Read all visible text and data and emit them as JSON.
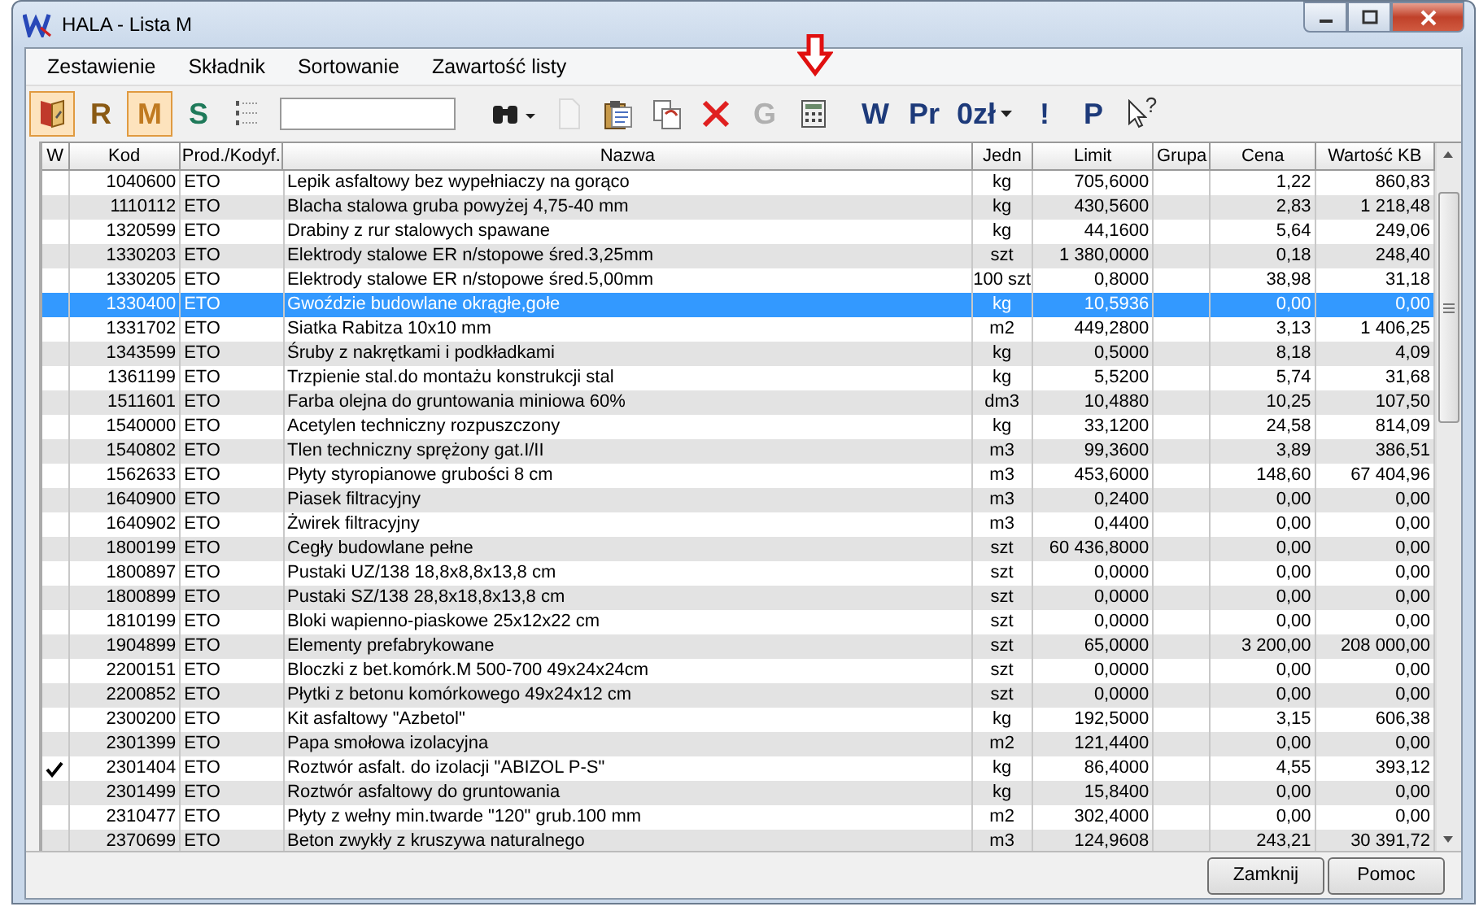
{
  "window": {
    "title": "HALA - Lista M"
  },
  "menu": [
    {
      "label": "Zestawienie"
    },
    {
      "label": "Składnik"
    },
    {
      "label": "Sortowanie"
    },
    {
      "label": "Zawartość listy"
    }
  ],
  "toolbar": [
    {
      "kind": "book",
      "selected": true
    },
    {
      "kind": "letter",
      "label": "R",
      "color": "#8a5a14",
      "selected": false
    },
    {
      "kind": "letter",
      "label": "M",
      "color": "#c07a20",
      "selected": true
    },
    {
      "kind": "letter",
      "label": "S",
      "color": "#1f7a5a",
      "selected": false
    },
    {
      "kind": "numbered-list"
    },
    {
      "kind": "search"
    },
    {
      "kind": "binoculars"
    },
    {
      "kind": "document",
      "disabled": true
    },
    {
      "kind": "clipboard"
    },
    {
      "kind": "copy"
    },
    {
      "kind": "delete"
    },
    {
      "kind": "letter",
      "label": "G",
      "color": "#b0b0b0",
      "selected": false
    },
    {
      "kind": "calculator",
      "highlighted": true
    },
    {
      "kind": "letter",
      "label": "W",
      "color": "#1d3a7a",
      "selected": false
    },
    {
      "kind": "letter",
      "label": "Pr",
      "color": "#1d3a7a",
      "selected": false
    },
    {
      "kind": "dropdown-letter",
      "label": "0zł",
      "color": "#1d3a7a",
      "selected": false
    },
    {
      "kind": "letter",
      "label": "!",
      "color": "#1d3a7a",
      "selected": false
    },
    {
      "kind": "letter",
      "label": "P",
      "color": "#1d3a7a",
      "selected": false
    },
    {
      "kind": "help-pointer",
      "label": "?"
    }
  ],
  "table": {
    "columns": [
      "W",
      "Kod",
      "Prod./Kodyf.",
      "Nazwa",
      "Jedn",
      "Limit",
      "Grupa",
      "Cena",
      "Wartość KB"
    ],
    "rows": [
      {
        "checked": false,
        "selected": false,
        "kod": "1040600",
        "prod": "ETO",
        "nazwa": "Lepik asfaltowy bez wypełniaczy na gorąco",
        "jedn": "kg",
        "limit": "705,6000",
        "cena": "1,22",
        "wartosc": "860,83"
      },
      {
        "checked": false,
        "selected": false,
        "kod": "1110112",
        "prod": "ETO",
        "nazwa": "Blacha stalowa gruba powyżej 4,75-40 mm",
        "jedn": "kg",
        "limit": "430,5600",
        "cena": "2,83",
        "wartosc": "1 218,48"
      },
      {
        "checked": false,
        "selected": false,
        "kod": "1320599",
        "prod": "ETO",
        "nazwa": "Drabiny z rur stalowych spawane",
        "jedn": "kg",
        "limit": "44,1600",
        "cena": "5,64",
        "wartosc": "249,06"
      },
      {
        "checked": false,
        "selected": false,
        "kod": "1330203",
        "prod": "ETO",
        "nazwa": "Elektrody stalowe ER n/stopowe śred.3,25mm",
        "jedn": "szt",
        "limit": "1 380,0000",
        "cena": "0,18",
        "wartosc": "248,40"
      },
      {
        "checked": false,
        "selected": false,
        "kod": "1330205",
        "prod": "ETO",
        "nazwa": "Elektrody stalowe ER n/stopowe śred.5,00mm",
        "jedn": "100 szt",
        "limit": "0,8000",
        "cena": "38,98",
        "wartosc": "31,18"
      },
      {
        "checked": false,
        "selected": true,
        "kod": "1330400",
        "prod": "ETO",
        "nazwa": "Gwoździe budowlane okrągłe,gołe",
        "jedn": "kg",
        "limit": "10,5936",
        "cena": "0,00",
        "wartosc": "0,00"
      },
      {
        "checked": false,
        "selected": false,
        "kod": "1331702",
        "prod": "ETO",
        "nazwa": "Siatka Rabitza 10x10 mm",
        "jedn": "m2",
        "limit": "449,2800",
        "cena": "3,13",
        "wartosc": "1 406,25"
      },
      {
        "checked": false,
        "selected": false,
        "kod": "1343599",
        "prod": "ETO",
        "nazwa": "Śruby z nakrętkami i podkładkami",
        "jedn": "kg",
        "limit": "0,5000",
        "cena": "8,18",
        "wartosc": "4,09"
      },
      {
        "checked": false,
        "selected": false,
        "kod": "1361199",
        "prod": "ETO",
        "nazwa": "Trzpienie stal.do montażu konstrukcji stal",
        "jedn": "kg",
        "limit": "5,5200",
        "cena": "5,74",
        "wartosc": "31,68"
      },
      {
        "checked": false,
        "selected": false,
        "kod": "1511601",
        "prod": "ETO",
        "nazwa": "Farba olejna do gruntowania miniowa 60%",
        "jedn": "dm3",
        "limit": "10,4880",
        "cena": "10,25",
        "wartosc": "107,50"
      },
      {
        "checked": false,
        "selected": false,
        "kod": "1540000",
        "prod": "ETO",
        "nazwa": "Acetylen techniczny rozpuszczony",
        "jedn": "kg",
        "limit": "33,1200",
        "cena": "24,58",
        "wartosc": "814,09"
      },
      {
        "checked": false,
        "selected": false,
        "kod": "1540802",
        "prod": "ETO",
        "nazwa": "Tlen techniczny sprężony gat.I/II",
        "jedn": "m3",
        "limit": "99,3600",
        "cena": "3,89",
        "wartosc": "386,51"
      },
      {
        "checked": false,
        "selected": false,
        "kod": "1562633",
        "prod": "ETO",
        "nazwa": "Płyty styropianowe grubości  8 cm",
        "jedn": "m3",
        "limit": "453,6000",
        "cena": "148,60",
        "wartosc": "67 404,96"
      },
      {
        "checked": false,
        "selected": false,
        "kod": "1640900",
        "prod": "ETO",
        "nazwa": "Piasek filtracyjny",
        "jedn": "m3",
        "limit": "0,2400",
        "cena": "0,00",
        "wartosc": "0,00"
      },
      {
        "checked": false,
        "selected": false,
        "kod": "1640902",
        "prod": "ETO",
        "nazwa": "Żwirek filtracyjny",
        "jedn": "m3",
        "limit": "0,4400",
        "cena": "0,00",
        "wartosc": "0,00"
      },
      {
        "checked": false,
        "selected": false,
        "kod": "1800199",
        "prod": "ETO",
        "nazwa": "Cegły budowlane pełne",
        "jedn": "szt",
        "limit": "60 436,8000",
        "cena": "0,00",
        "wartosc": "0,00"
      },
      {
        "checked": false,
        "selected": false,
        "kod": "1800897",
        "prod": "ETO",
        "nazwa": "Pustaki UZ/138 18,8x8,8x13,8 cm",
        "jedn": "szt",
        "limit": "0,0000",
        "cena": "0,00",
        "wartosc": "0,00"
      },
      {
        "checked": false,
        "selected": false,
        "kod": "1800899",
        "prod": "ETO",
        "nazwa": "Pustaki SZ/138 28,8x18,8x13,8 cm",
        "jedn": "szt",
        "limit": "0,0000",
        "cena": "0,00",
        "wartosc": "0,00"
      },
      {
        "checked": false,
        "selected": false,
        "kod": "1810199",
        "prod": "ETO",
        "nazwa": "Bloki wapienno-piaskowe 25x12x22 cm",
        "jedn": "szt",
        "limit": "0,0000",
        "cena": "0,00",
        "wartosc": "0,00"
      },
      {
        "checked": false,
        "selected": false,
        "kod": "1904899",
        "prod": "ETO",
        "nazwa": "Elementy prefabrykowane",
        "jedn": "szt",
        "limit": "65,0000",
        "cena": "3 200,00",
        "wartosc": "208 000,00"
      },
      {
        "checked": false,
        "selected": false,
        "kod": "2200151",
        "prod": "ETO",
        "nazwa": "Bloczki z bet.komórk.M 500-700 49x24x24cm",
        "jedn": "szt",
        "limit": "0,0000",
        "cena": "0,00",
        "wartosc": "0,00"
      },
      {
        "checked": false,
        "selected": false,
        "kod": "2200852",
        "prod": "ETO",
        "nazwa": "Płytki z betonu komórkowego 49x24x12 cm",
        "jedn": "szt",
        "limit": "0,0000",
        "cena": "0,00",
        "wartosc": "0,00"
      },
      {
        "checked": false,
        "selected": false,
        "kod": "2300200",
        "prod": "ETO",
        "nazwa": "Kit asfaltowy \"Azbetol\"",
        "jedn": "kg",
        "limit": "192,5000",
        "cena": "3,15",
        "wartosc": "606,38"
      },
      {
        "checked": false,
        "selected": false,
        "kod": "2301399",
        "prod": "ETO",
        "nazwa": "Papa smołowa izolacyjna",
        "jedn": "m2",
        "limit": "121,4400",
        "cena": "0,00",
        "wartosc": "0,00"
      },
      {
        "checked": true,
        "selected": false,
        "kod": "2301404",
        "prod": "ETO",
        "nazwa": "Roztwór asfalt. do izolacji \"ABIZOL P-S\"",
        "jedn": "kg",
        "limit": "86,4000",
        "cena": "4,55",
        "wartosc": "393,12"
      },
      {
        "checked": false,
        "selected": false,
        "kod": "2301499",
        "prod": "ETO",
        "nazwa": "Roztwór asfaltowy do gruntowania",
        "jedn": "kg",
        "limit": "15,8400",
        "cena": "0,00",
        "wartosc": "0,00"
      },
      {
        "checked": false,
        "selected": false,
        "kod": "2310477",
        "prod": "ETO",
        "nazwa": "Płyty z wełny min.twarde \"120\" grub.100 mm",
        "jedn": "m2",
        "limit": "302,4000",
        "cena": "0,00",
        "wartosc": "0,00"
      },
      {
        "checked": false,
        "selected": false,
        "kod": "2370699",
        "prod": "ETO",
        "nazwa": "Beton zwykły z kruszywa naturalnego",
        "jedn": "m3",
        "limit": "124,9608",
        "cena": "243,21",
        "wartosc": "30 391,72"
      }
    ]
  },
  "buttons": [
    {
      "label": "Zamknij"
    },
    {
      "label": "Pomoc"
    }
  ]
}
